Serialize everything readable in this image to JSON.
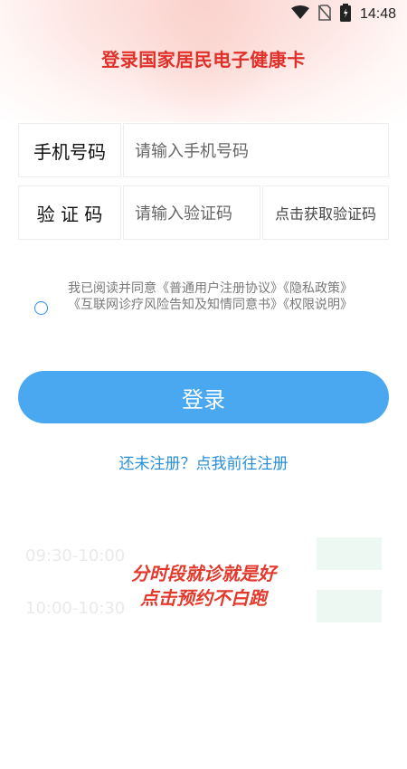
{
  "status_bar": {
    "time": "14:48"
  },
  "header": {
    "title": "登录国家居民电子健康卡"
  },
  "form": {
    "phone_label": "手机号码",
    "phone_placeholder": "请输入手机号码",
    "code_label": "验 证 码",
    "code_placeholder": "请输入验证码",
    "get_code_label": "点击获取验证码"
  },
  "agreement": {
    "text": "我已阅读并同意《普通用户注册协议》《隐私政策》《互联网诊疗风险告知及知情同意书》《权限说明》"
  },
  "login_button": "登录",
  "register_link": "还未注册？点我前往注册",
  "promo": {
    "slots": [
      "09:30-10:00",
      "10:00-10:30"
    ],
    "line1": "分时段就诊就是好",
    "line2": "点击预约不白跑"
  },
  "colors": {
    "title_red": "#e0302a",
    "button_blue": "#4aa8f0",
    "link_blue": "#2a8fd8"
  }
}
